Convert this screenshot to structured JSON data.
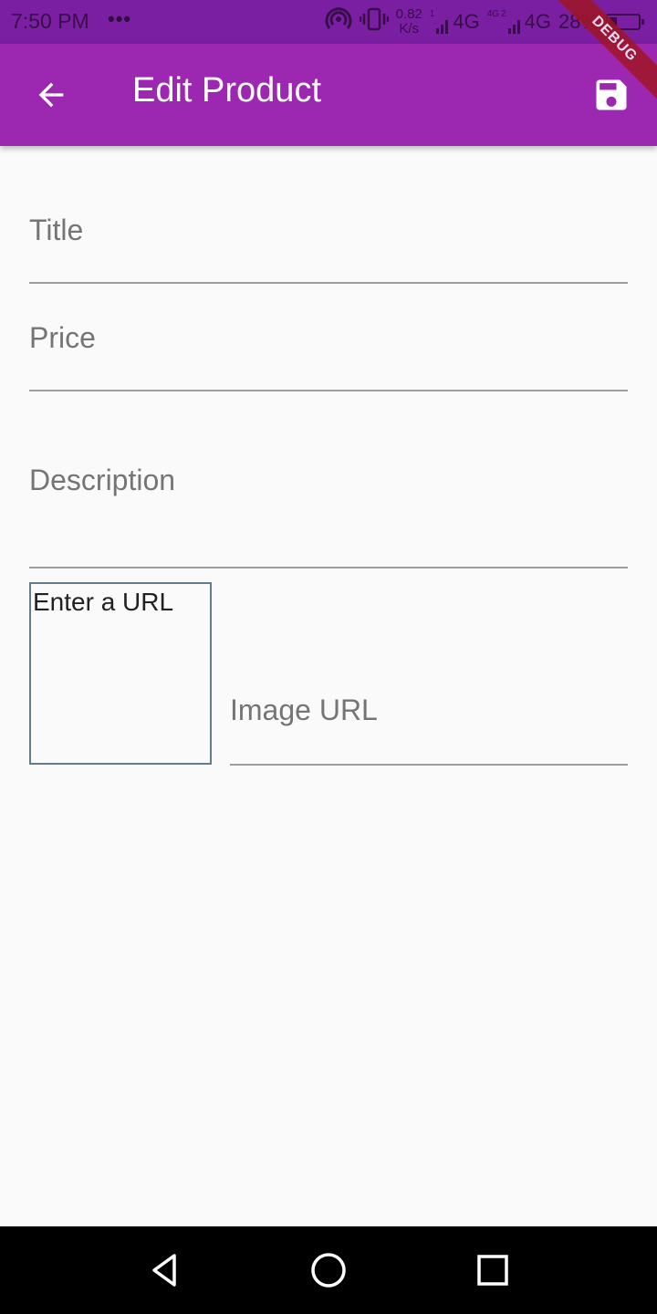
{
  "status_bar": {
    "time": "7:50 PM",
    "more": "•••",
    "speed_value": "0.82",
    "speed_unit": "K/s",
    "net1_sim": "1",
    "net1_label": "4G",
    "net2_sim_a": "4G",
    "net2_sim_b": "2",
    "net2_label": "4G",
    "battery": "28%",
    "battery_level": 0.28
  },
  "debug_banner": "DEBUG",
  "app_bar": {
    "title": "Edit Product",
    "back_icon": "arrow-back-icon",
    "save_icon": "save-icon",
    "background_color": "#9c27b0"
  },
  "form": {
    "title_label": "Title",
    "price_label": "Price",
    "description_label": "Description",
    "image_preview_text": "Enter a URL",
    "image_url_label": "Image URL"
  },
  "nav_bar": {
    "back_icon": "triangle-back-icon",
    "home_icon": "circle-home-icon",
    "recents_icon": "square-recents-icon"
  }
}
